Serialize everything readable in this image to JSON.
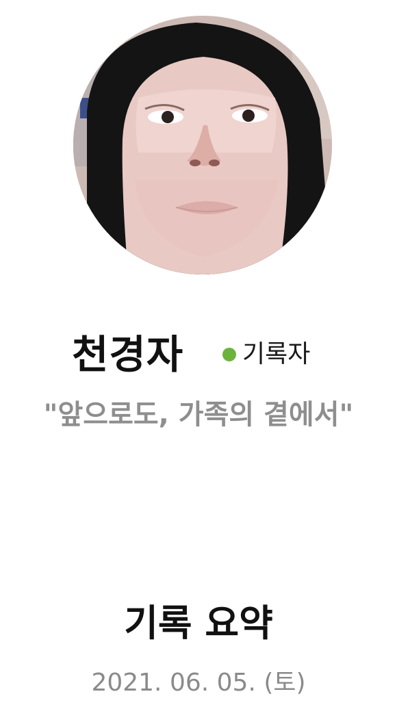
{
  "profile": {
    "name": "천경자",
    "role_label": "기록자",
    "status_color": "#6cb33e",
    "quote": "\"앞으로도, 가족의 곁에서\""
  },
  "summary": {
    "title": "기록 요약",
    "date": "2021. 06. 05. (토)"
  }
}
